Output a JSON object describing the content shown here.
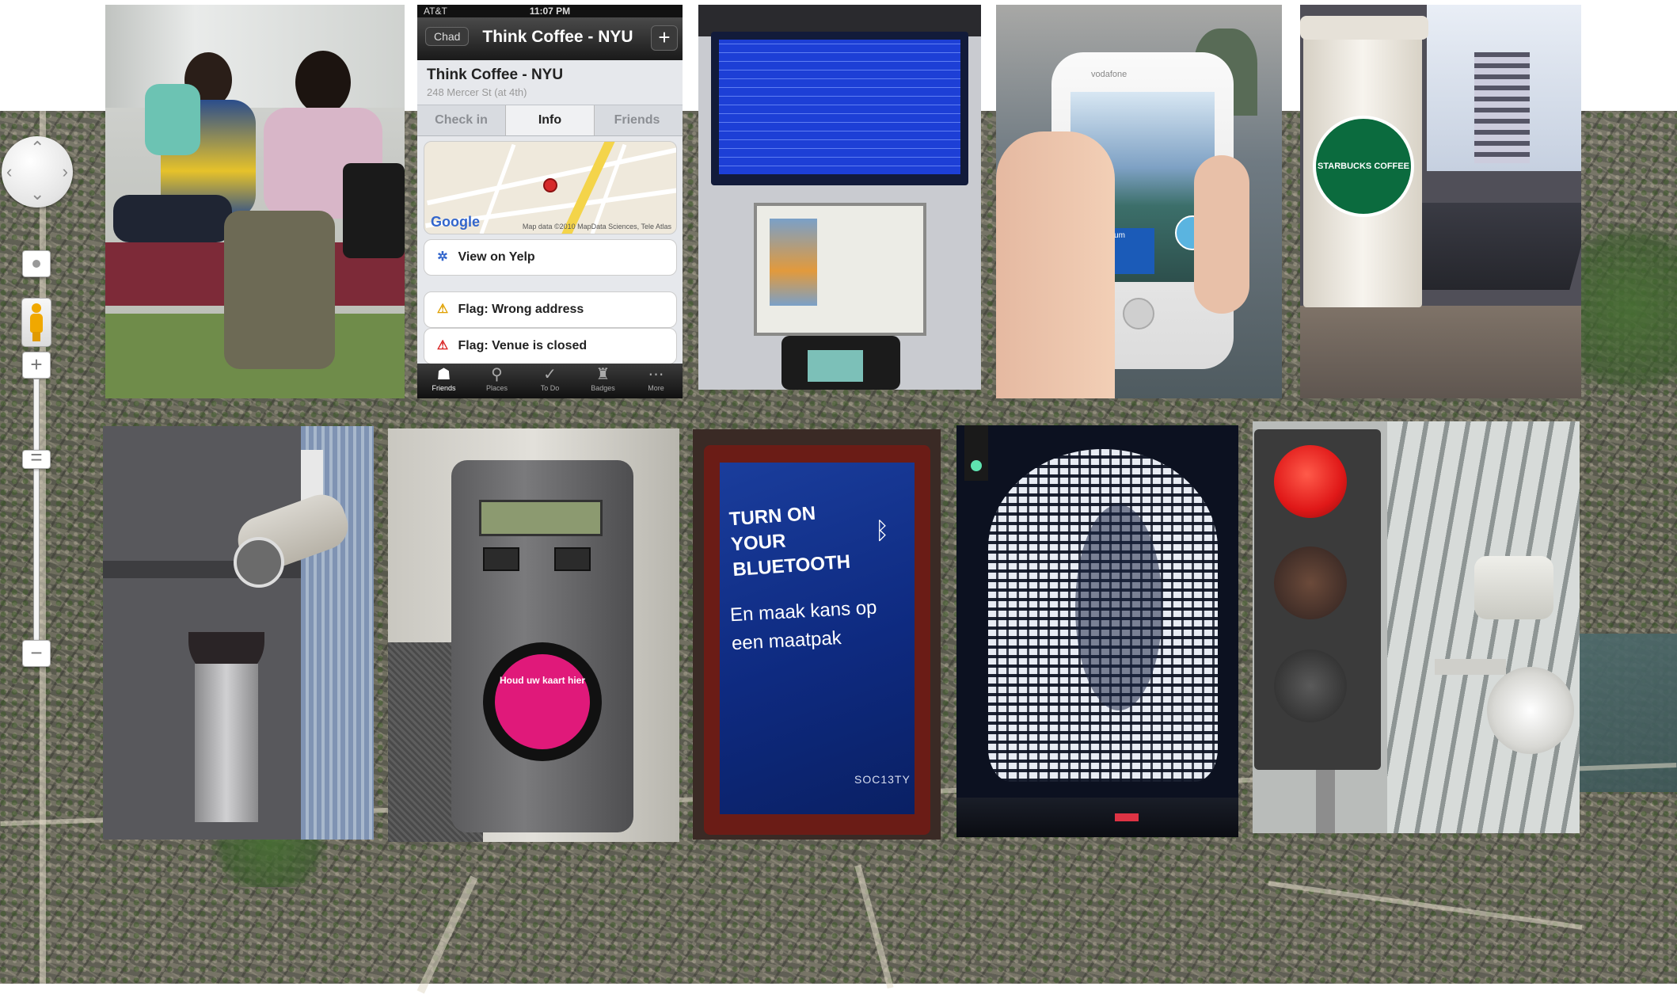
{
  "map": {
    "controls": {
      "pan_up_glyph": "‹",
      "zoom_in_label": "+",
      "zoom_out_label": "−",
      "zoom_thumb_label": "="
    }
  },
  "photos": {
    "iphone": {
      "carrier": "AT&T",
      "time": "11:07 PM",
      "back_label": "Chad",
      "nav_title": "Think Coffee - NYU",
      "add_label": "+",
      "venue_name": "Think Coffee - NYU",
      "venue_address": "248 Mercer St (at 4th)",
      "tabs": [
        "Check in",
        "Info",
        "Friends"
      ],
      "map_logo": "Google",
      "map_copyright": "Map data ©2010 MapData Sciences, Tele Atlas",
      "view_on_yelp": "View on Yelp",
      "flag_wrong_address": "Flag: Wrong address",
      "flag_venue_closed": "Flag: Venue is closed",
      "tabbar": [
        "Friends",
        "Places",
        "To Do",
        "Badges",
        "More"
      ]
    },
    "android": {
      "brand": "vodafone",
      "overlay_title": "Leijsmuseum"
    },
    "starbucks": {
      "cup_text": "STARBUCKS COFFEE"
    },
    "card_reader": {
      "sticker_text": "Houd uw kaart hier"
    },
    "poster": {
      "headline": "TURN ON YOUR BLUETOOTH",
      "body": "En maak kans op een maatpak",
      "brand": "SOC13TY"
    }
  },
  "colors": {
    "map_base": "#5b5a50",
    "poster_blue": "#1a3d9c",
    "reader_pink": "#e0197a",
    "red_light": "#e01818"
  }
}
